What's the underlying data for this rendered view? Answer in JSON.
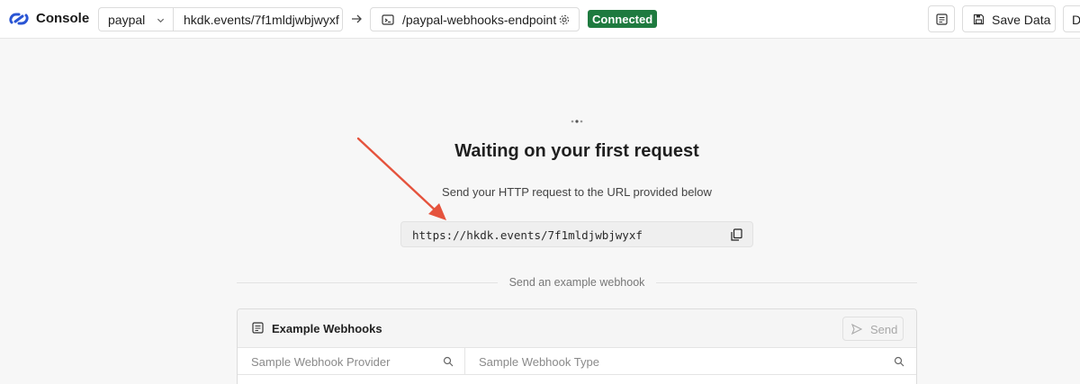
{
  "header": {
    "brand": "Console",
    "source_name": "paypal",
    "source_url": "hkdk.events/7f1mldjwbjwyxf",
    "destination_path": "/paypal-webhooks-endpoint",
    "status_badge": "Connected",
    "save_label": "Save Data",
    "truncated_button_label": "D"
  },
  "main": {
    "title": "Waiting on your first request",
    "subtitle": "Send your HTTP request to the URL provided below",
    "request_url": "https://hkdk.events/7f1mldjwbjwyxf",
    "divider_label": "Send an example webhook"
  },
  "example_panel": {
    "title": "Example Webhooks",
    "send_label": "Send",
    "provider_placeholder": "Sample Webhook Provider",
    "type_placeholder": "Sample Webhook Type"
  },
  "colors": {
    "accent": "#2a55d4",
    "connected": "#1e7a3f",
    "annotation_arrow": "#e5533d",
    "background": "#f7f7f7"
  },
  "icons": {
    "logo": "chain-link-logo",
    "dropdown": "chevron-down-icon",
    "arrow": "arrow-right-icon",
    "destination": "terminal-icon",
    "settings": "gear-icon",
    "requests": "list-icon",
    "save": "floppy-disk-icon",
    "copy": "copy-icon",
    "send": "send-icon",
    "search": "search-icon"
  }
}
